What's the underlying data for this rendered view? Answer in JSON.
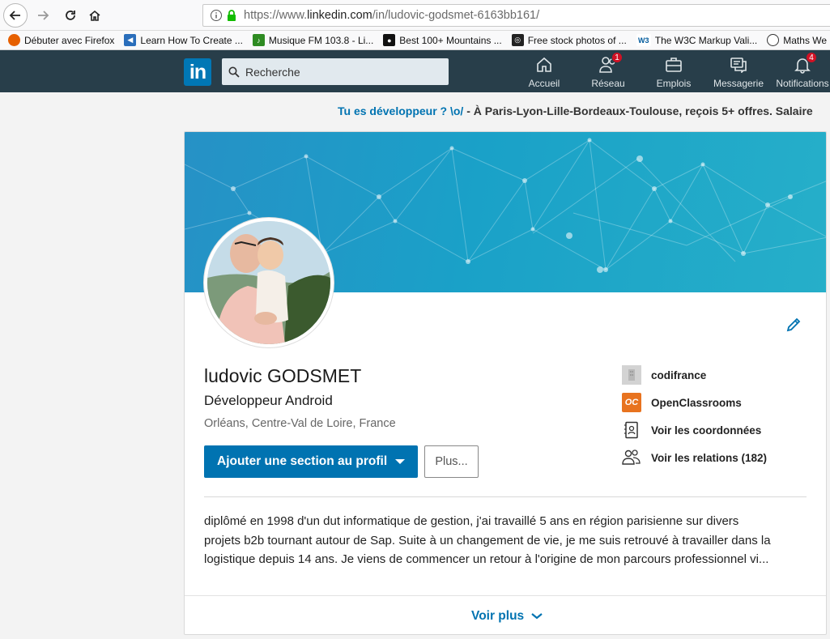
{
  "browser": {
    "url_pre": "https://www.",
    "url_host": "linkedin.com",
    "url_rest": "/in/ludovic-godsmet-6163bb161/",
    "bookmarks": [
      {
        "label": "Débuter avec Firefox",
        "icon": "firefox-icon",
        "color": "#e66000"
      },
      {
        "label": "Learn How To Create ...",
        "icon": "film-icon",
        "color": "#2a6ebb"
      },
      {
        "label": "Musique FM 103.8 - Li...",
        "icon": "music-icon",
        "color": "#2e8b22"
      },
      {
        "label": "Best 100+ Mountains ...",
        "icon": "camera-icon",
        "color": "#111111"
      },
      {
        "label": "Free stock photos of ...",
        "icon": "camera-icon",
        "color": "#222222"
      },
      {
        "label": "The W3C Markup Vali...",
        "icon": "w3c-icon",
        "color": "#005a9c"
      },
      {
        "label": "Maths We",
        "icon": "globe-icon",
        "color": "#333333"
      }
    ]
  },
  "header": {
    "logo": "in",
    "search_placeholder": "Recherche",
    "nav": [
      {
        "label": "Accueil",
        "icon": "home-icon",
        "badge": ""
      },
      {
        "label": "Réseau",
        "icon": "network-icon",
        "badge": "1"
      },
      {
        "label": "Emplois",
        "icon": "briefcase-icon",
        "badge": ""
      },
      {
        "label": "Messagerie",
        "icon": "messaging-icon",
        "badge": ""
      },
      {
        "label": "Notifications",
        "icon": "bell-icon",
        "badge": "4"
      }
    ]
  },
  "promo": {
    "link": "Tu es développeur ? \\o/",
    "text": " - À Paris-Lyon-Lille-Bordeaux-Toulouse, reçois 5+ offres. Salaire"
  },
  "profile": {
    "name": "ludovic GODSMET",
    "headline": "Développeur Android",
    "location": "Orléans, Centre-Val de Loire, France",
    "add_section_label": "Ajouter une section au profil",
    "more_label": "Plus...",
    "side": [
      {
        "label": "codifrance",
        "icon": "company-icon"
      },
      {
        "label": "OpenClassrooms",
        "icon": "openclassrooms-icon"
      },
      {
        "label": "Voir les coordonnées",
        "icon": "contact-icon"
      },
      {
        "label": "Voir les relations (182)",
        "icon": "connections-icon"
      }
    ],
    "openclassrooms_logo": "OC",
    "summary_lines": [
      "diplômé en 1998 d'un dut informatique de gestion, j'ai travaillé 5 ans en région parisienne sur divers",
      "projets b2b tournant autour de Sap. Suite à un changement de vie, je me suis retrouvé à travailler dans la",
      "logistique depuis 14 ans. Je viens de commencer un retour à l'origine de mon parcours professionnel vi..."
    ],
    "see_more_label": "Voir plus"
  },
  "colors": {
    "linkedin_blue": "#0073b1",
    "header_bg": "#283e4a",
    "badge_red": "#d11124"
  }
}
